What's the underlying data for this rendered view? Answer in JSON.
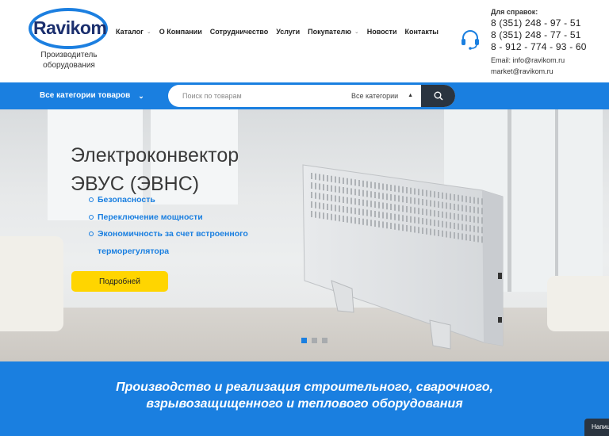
{
  "header": {
    "logo_text": "Ravikom",
    "logo_subtitle": "Производитель оборудования",
    "nav": [
      {
        "label": "Каталог",
        "dropdown": true
      },
      {
        "label": "О Компании",
        "dropdown": false
      },
      {
        "label": "Сотрудничество",
        "dropdown": false
      },
      {
        "label": "Услуги",
        "dropdown": false
      },
      {
        "label": "Покупателю",
        "dropdown": true
      },
      {
        "label": "Новости",
        "dropdown": false
      },
      {
        "label": "Контакты",
        "dropdown": false
      }
    ],
    "contacts": {
      "label": "Для справок:",
      "phones": [
        "8 (351) 248 - 97 - 51",
        "8 (351) 248 - 77 - 51",
        "8 - 912 - 774 - 93 - 60"
      ],
      "email1": "Email: info@ravikom.ru",
      "email2": "market@ravikom.ru"
    }
  },
  "toolbar": {
    "categories_label": "Все категории товаров",
    "search_placeholder": "Поиск по товарам",
    "search_category": "Все категории"
  },
  "hero": {
    "title_line1": "Электроконвектор",
    "title_line2": "ЭВУС (ЭВНС)",
    "features": [
      "Безопасность",
      "Переключение мощности",
      "Экономичность за счет встроенного терморегулятора"
    ],
    "button_label": "Подробней",
    "slides_total": 3,
    "slide_active": 1
  },
  "banner": {
    "line1": "Производство и реализация строительного, сварочного,",
    "line2": "взрывозащищенного и теплового оборудования"
  },
  "chat": {
    "label": "Напишите нам"
  },
  "colors": {
    "accent": "#1a7fe0",
    "button": "#ffd500",
    "dark": "#2a3440",
    "logo": "#1b2f6e"
  },
  "icons": {
    "headset": "headset-icon",
    "search": "search-icon",
    "chevron": "chevron-down-icon"
  }
}
